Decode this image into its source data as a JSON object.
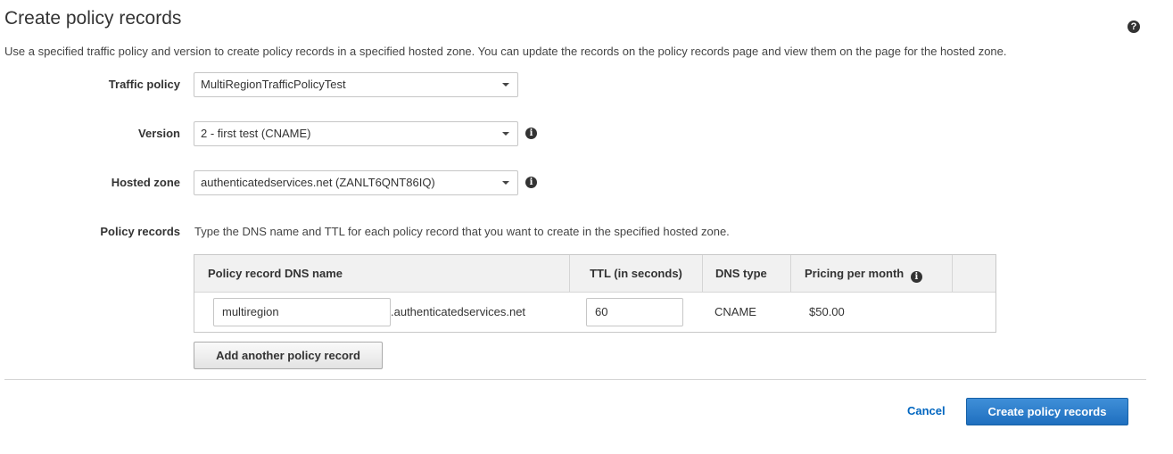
{
  "header": {
    "title": "Create policy records",
    "help_icon_glyph": "?",
    "description": "Use a specified traffic policy and version to create policy records in a specified hosted zone. You can update the records on the policy records page and view them on the page for the hosted zone."
  },
  "form": {
    "traffic_policy": {
      "label": "Traffic policy",
      "value": "MultiRegionTrafficPolicyTest"
    },
    "version": {
      "label": "Version",
      "value": "2 - first test (CNAME)"
    },
    "hosted_zone": {
      "label": "Hosted zone",
      "value": "authenticatedservices.net (ZANLT6QNT86IQ)"
    },
    "policy_records": {
      "label": "Policy records",
      "instructions": "Type the DNS name and TTL for each policy record that you want to create in the specified hosted zone."
    }
  },
  "table": {
    "columns": {
      "dns_name": "Policy record DNS name",
      "ttl": "TTL (in seconds)",
      "dns_type": "DNS type",
      "pricing": "Pricing per month"
    },
    "rows": [
      {
        "dns_name": "multiregion",
        "domain_suffix": ".authenticatedservices.net",
        "ttl": "60",
        "dns_type": "CNAME",
        "pricing": "$50.00"
      }
    ]
  },
  "actions": {
    "add_record": "Add another policy record",
    "cancel": "Cancel",
    "create": "Create policy records"
  },
  "info_icon_glyph": "i",
  "colors": {
    "primary_button": "#1f6fbf",
    "link": "#0066c0",
    "header_bg": "#f1f1f1"
  }
}
